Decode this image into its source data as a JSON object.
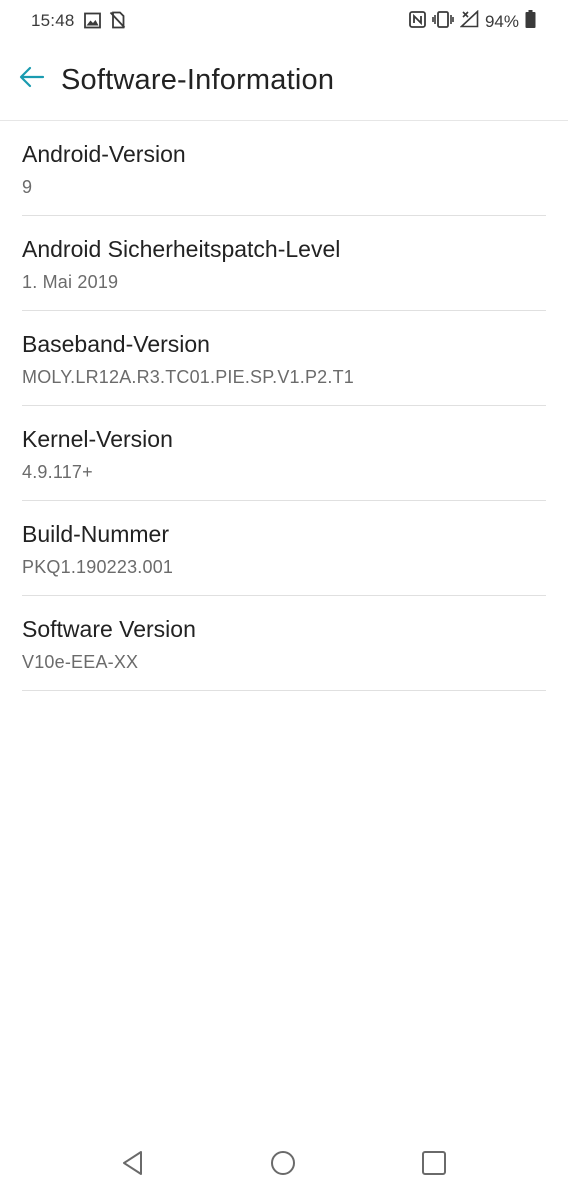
{
  "status_bar": {
    "time": "15:48",
    "battery": "94%",
    "left_icons": [
      "image-icon",
      "no-sim-icon"
    ],
    "right_icons": [
      "nfc-icon",
      "vibrate-icon",
      "no-signal-icon",
      "battery-icon"
    ]
  },
  "toolbar": {
    "title": "Software-Information",
    "back_icon": "arrow-left-icon",
    "accent_color": "#1a9bb0"
  },
  "items": [
    {
      "title": "Android-Version",
      "value": "9"
    },
    {
      "title": "Android Sicherheitspatch-Level",
      "value": "1. Mai 2019"
    },
    {
      "title": "Baseband-Version",
      "value": "MOLY.LR12A.R3.TC01.PIE.SP.V1.P2.T1"
    },
    {
      "title": "Kernel-Version",
      "value": "4.9.117+"
    },
    {
      "title": "Build-Nummer",
      "value": "PKQ1.190223.001"
    },
    {
      "title": "Software Version",
      "value": "V10e-EEA-XX"
    }
  ],
  "nav_bar": {
    "buttons": [
      "back-triangle-icon",
      "home-circle-icon",
      "recents-square-icon"
    ]
  }
}
